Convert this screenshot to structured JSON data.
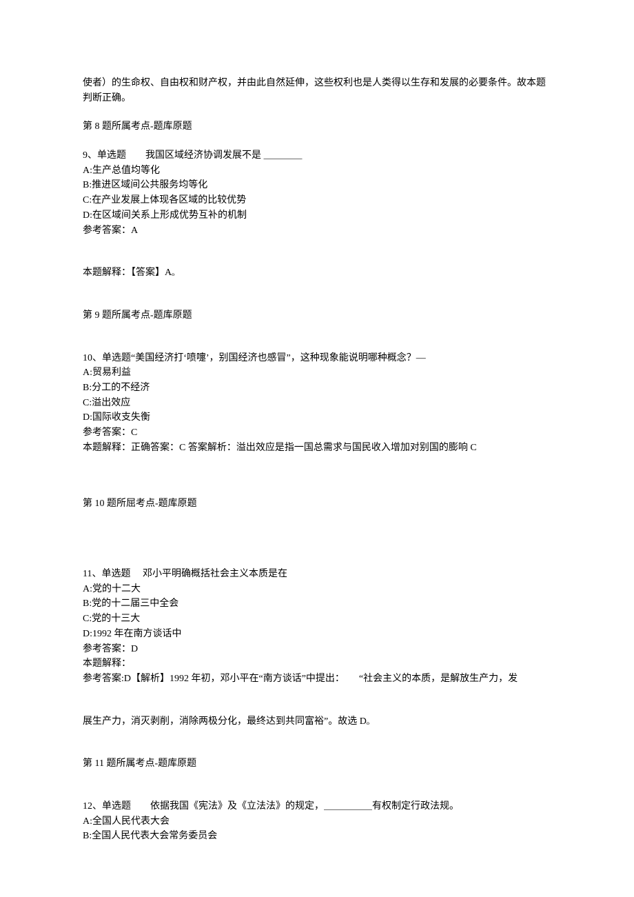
{
  "q8": {
    "tail": "使者）的生命权、自由权和财产权，并由此自然延伸，这些权利也是人类得以生存和发展的必要条件。故本题判断正确。",
    "topic": "第 8 题所属考点-题库原题"
  },
  "q9": {
    "stem": "9、单选题　　我国区域经济协调发展不是 ＿＿＿＿",
    "optA": "A:生产总值均等化",
    "optB": "B:推进区域间公共服务均等化",
    "optC": "C:在产业发展上体现各区域的比较优势",
    "optD": "D:在区域间关系上形成优势互补的机制",
    "ref": "参考答案：A",
    "explain": "本题解释：【答案】Aₒ",
    "topic": "第 9 题所属考点-题库原题"
  },
  "q10": {
    "stem": "10、单选题“美国经济打‘喷嚏’，别国经济也感冒”，这种现象能说明哪种概念？—",
    "optA": "A:贸易利益",
    "optB": "B:分工的不经济",
    "optC": "C:溢出效应",
    "optD": "D:国际收支失衡",
    "ref": "参考答案：C",
    "explain": "本题解释：正确答案：C 答案解析：溢出效应是指一国总需求与国民收入增加对别国的膨响 C",
    "topic": "第 10 题所屈考点-题库原题"
  },
  "q11": {
    "stem": "11、单选题　 邓小平明确概括社会主义本质是在",
    "optA": "A:党的十二大",
    "optB": "B:党的十二届三中全会",
    "optC": "C:党的十三大",
    "optD": "D:1992 年在南方谈话中",
    "ref": "参考答案：D",
    "explain1": "本题解释：",
    "explain2": "参考答案:D【解析】1992 年初，邓小平在“南方谈话”中提出：　　“社会主义的本质，是解放生产力，发",
    "explain3": "展生产力，消灭剥削，消除两极分化，最终达到共同富裕”。故选 Dₒ",
    "topic": "第 11 题所属考点-题库原题"
  },
  "q12": {
    "stem": "12、单选题　　依据我国《宪法》及《立法法》的规定，＿＿＿＿＿有权制定行政法规。",
    "optA": "A:全国人民代表大会",
    "optB": "B:全国人民代表大会常务委员会"
  }
}
